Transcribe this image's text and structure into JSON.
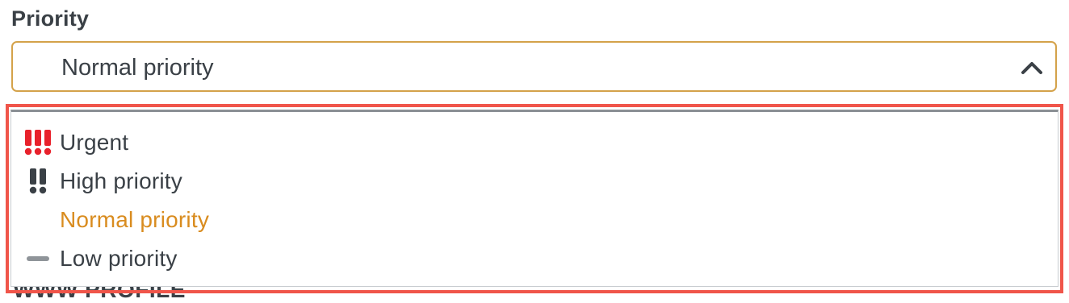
{
  "field": {
    "label": "Priority",
    "selected_value": "Normal priority",
    "next_field_label": "WWW PROFILE"
  },
  "dropdown": {
    "options": [
      {
        "label": "Urgent",
        "icon": "urgent-exclamation-icon",
        "selected": false
      },
      {
        "label": "High priority",
        "icon": "high-exclamation-icon",
        "selected": false
      },
      {
        "label": "Normal priority",
        "icon": "",
        "selected": true
      },
      {
        "label": "Low priority",
        "icon": "low-dash-icon",
        "selected": false
      }
    ]
  },
  "colors": {
    "accent": "#d98c1f",
    "border_focus": "#d4a24a",
    "urgent": "#e8212b",
    "high": "#3a4046",
    "low": "#8f9499",
    "highlight_frame": "#f0554a"
  }
}
